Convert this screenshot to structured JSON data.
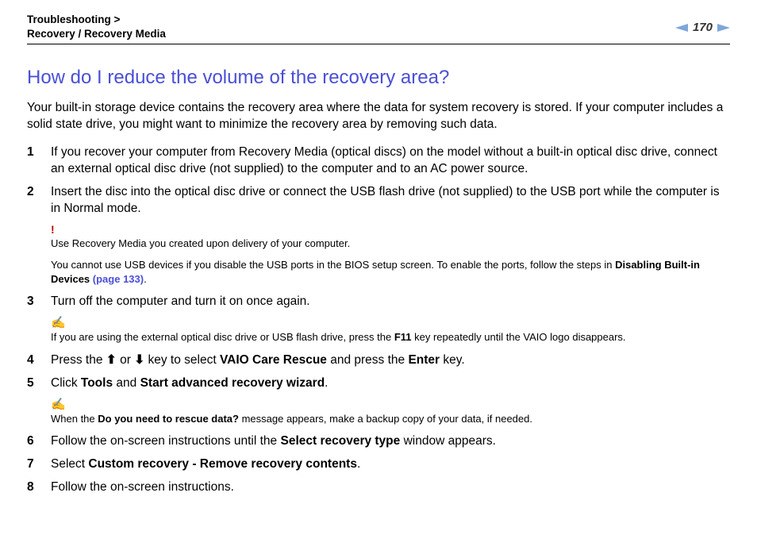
{
  "header": {
    "breadcrumb_line1": "Troubleshooting >",
    "breadcrumb_line2": "Recovery / Recovery Media",
    "page_number": "170"
  },
  "title": "How do I reduce the volume of the recovery area?",
  "intro": "Your built-in storage device contains the recovery area where the data for system recovery is stored. If your computer includes a solid state drive, you might want to minimize the recovery area by removing such data.",
  "steps": {
    "s1_num": "1",
    "s1_text": "If you recover your computer from Recovery Media (optical discs) on the model without a built-in optical disc drive, connect an external optical disc drive (not supplied) to the computer and to an AC power source.",
    "s2_num": "2",
    "s2_text": "Insert the disc into the optical disc drive or connect the USB flash drive (not supplied) to the USB port while the computer is in Normal mode.",
    "s3_num": "3",
    "s3_text": "Turn off the computer and turn it on once again.",
    "s4_num": "4",
    "s4_pre": "Press the ",
    "s4_up": "⬆",
    "s4_mid": " or ",
    "s4_down": "⬇",
    "s4_mid2": " key to select ",
    "s4_bold1": "VAIO Care Rescue",
    "s4_mid3": " and press the ",
    "s4_bold2": "Enter",
    "s4_end": " key.",
    "s5_num": "5",
    "s5_pre": "Click ",
    "s5_bold1": "Tools",
    "s5_mid": " and ",
    "s5_bold2": "Start advanced recovery wizard",
    "s5_end": ".",
    "s6_num": "6",
    "s6_pre": "Follow the on-screen instructions until the ",
    "s6_bold": "Select recovery type",
    "s6_end": " window appears.",
    "s7_num": "7",
    "s7_pre": "Select ",
    "s7_bold": "Custom recovery - Remove recovery contents",
    "s7_end": ".",
    "s8_num": "8",
    "s8_text": "Follow the on-screen instructions."
  },
  "notes": {
    "warn_icon": "!",
    "warn1": "Use Recovery Media you created upon delivery of your computer.",
    "warn2_pre": "You cannot use USB devices if you disable the USB ports in the BIOS setup screen. To enable the ports, follow the steps in ",
    "warn2_bold": "Disabling Built-in Devices",
    "warn2_link": "(page 133)",
    "warn2_end": ".",
    "pencil_icon": "✍",
    "tip1_pre": "If you are using the external optical disc drive or USB flash drive, press the ",
    "tip1_bold": "F11",
    "tip1_end": " key repeatedly until the VAIO logo disappears.",
    "tip2_pre": "When the ",
    "tip2_bold": "Do you need to rescue data?",
    "tip2_end": " message appears, make a backup copy of your data, if needed."
  }
}
